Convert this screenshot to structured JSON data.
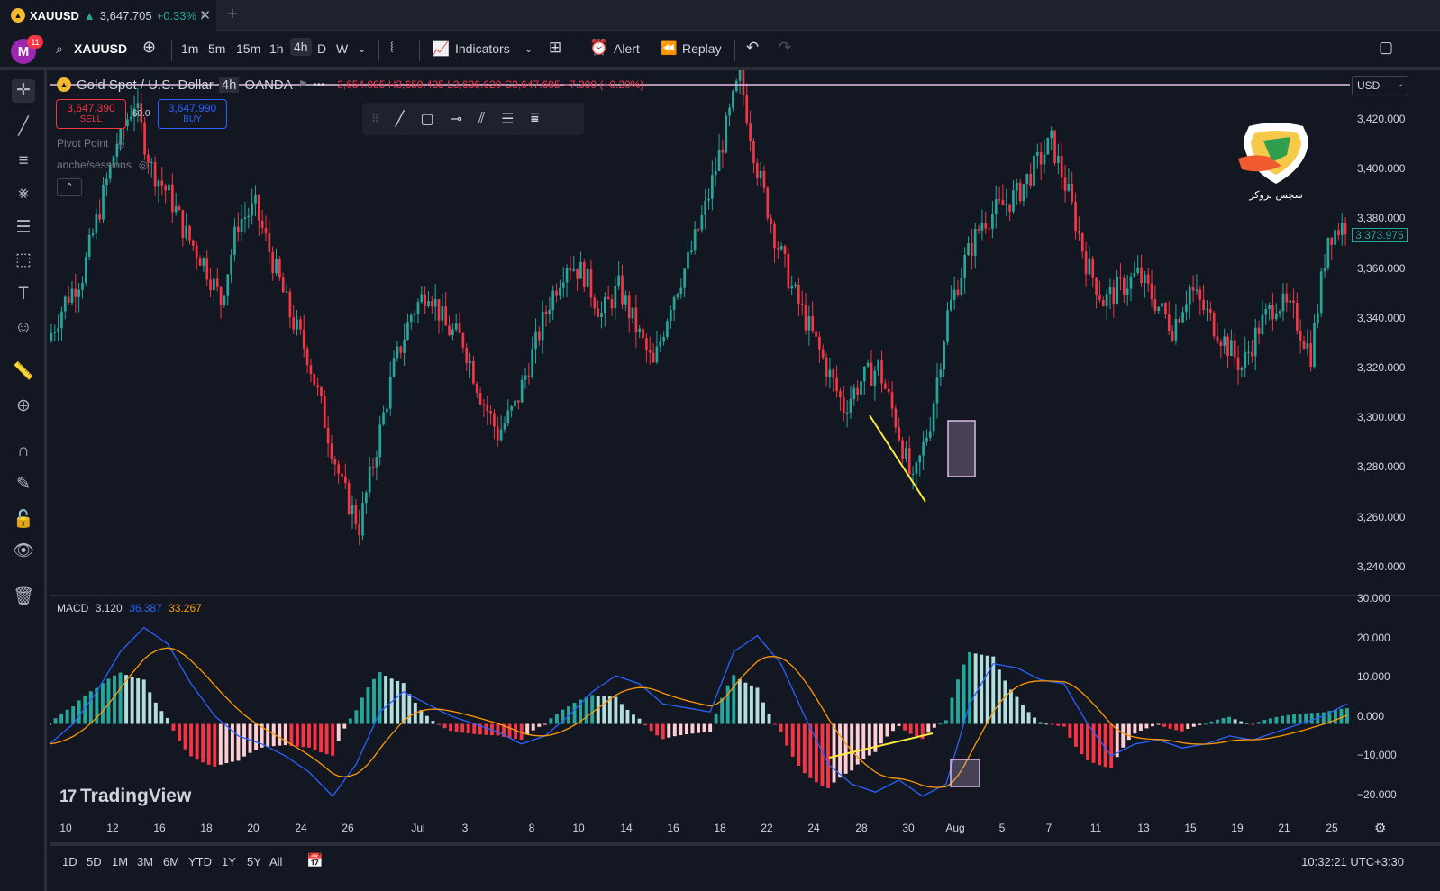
{
  "tab": {
    "symbol": "XAUUSD",
    "price": "3,647.705",
    "change": "+0.33%",
    "sep": "/",
    "coin_glyph": "▲"
  },
  "toolbar": {
    "avatar_letter": "M",
    "notifications": "11",
    "symbol": "XAUUSD",
    "intervals": [
      "1m",
      "5m",
      "15m",
      "1h",
      "4h",
      "D",
      "W"
    ],
    "active_interval": "4h",
    "indicators_label": "Indicators",
    "alert_label": "Alert",
    "replay_label": "Replay"
  },
  "legend": {
    "name": "Gold Spot / U.S. Dollar",
    "interval": "4h",
    "broker": "OANDA",
    "ohlc": "3,654.985 H3,659.435 L3,636.620 C3,647.695 −7.300 (−0.20%)",
    "sell_price": "3,647.390",
    "sell_label": "SELL",
    "buy_price": "3,647.990",
    "buy_label": "BUY",
    "spread": "60.0",
    "indicator1": "Pivot Point",
    "indicator2": "anche/sessions"
  },
  "price_axis": {
    "currency": "USD",
    "last_price": "3,373.975",
    "ticks": [
      "3,420.000",
      "3,400.000",
      "3,380.000",
      "3,360.000",
      "3,340.000",
      "3,320.000",
      "3,300.000",
      "3,280.000",
      "3,260.000",
      "3,240.000"
    ]
  },
  "macd": {
    "label": "MACD",
    "hist": "3.120",
    "macd": "36.387",
    "signal": "33.267",
    "ticks": [
      "30.000",
      "20.000",
      "10.000",
      "0.000",
      "−10.000",
      "−20.000"
    ]
  },
  "time_axis": {
    "labels": [
      "10",
      "12",
      "16",
      "18",
      "20",
      "24",
      "26",
      "Jul",
      "3",
      "8",
      "10",
      "14",
      "16",
      "18",
      "22",
      "24",
      "28",
      "30",
      "Aug",
      "5",
      "7",
      "11",
      "13",
      "15",
      "19",
      "21",
      "25"
    ]
  },
  "bottom": {
    "ranges": [
      "1D",
      "5D",
      "1M",
      "3M",
      "6M",
      "YTD",
      "1Y",
      "5Y",
      "All"
    ],
    "clock": "10:32:21 UTC+3:30"
  },
  "branding": {
    "tradingview": "TradingView",
    "watermark_text": "سجس بروکر"
  },
  "colors": {
    "up": "#26a69a",
    "down": "#f23645",
    "macd_line": "#2962ff",
    "signal_line": "#ff9800",
    "annotation": "#ffeb3b",
    "highlight_box": "#e1bee7"
  },
  "chart_data": {
    "type": "candlestick",
    "interval": "4h",
    "symbol": "XAUUSD",
    "ylim": [
      3235,
      3432
    ],
    "x_labels": [
      "10",
      "12",
      "16",
      "18",
      "20",
      "24",
      "26",
      "Jul",
      "3",
      "8",
      "10",
      "14",
      "16",
      "18",
      "22",
      "24",
      "28",
      "30",
      "Aug",
      "5",
      "7",
      "11",
      "13",
      "15",
      "19",
      "21",
      "25"
    ],
    "close_path_approx": [
      3330,
      3345,
      3355,
      3380,
      3405,
      3420,
      3395,
      3385,
      3370,
      3360,
      3345,
      3375,
      3380,
      3360,
      3340,
      3325,
      3300,
      3275,
      3260,
      3290,
      3320,
      3340,
      3350,
      3335,
      3330,
      3310,
      3295,
      3305,
      3325,
      3345,
      3360,
      3355,
      3340,
      3350,
      3335,
      3320,
      3345,
      3360,
      3380,
      3405,
      3430,
      3395,
      3370,
      3350,
      3335,
      3320,
      3305,
      3315,
      3320,
      3300,
      3275,
      3300,
      3340,
      3360,
      3375,
      3380,
      3385,
      3395,
      3405,
      3385,
      3360,
      3345,
      3350,
      3355,
      3345,
      3335,
      3350,
      3340,
      3330,
      3320,
      3335,
      3345,
      3340,
      3325,
      3370,
      3374
    ],
    "macd_path_approx": [
      -5,
      0,
      8,
      18,
      24,
      20,
      10,
      2,
      -3,
      -5,
      -8,
      -12,
      -18,
      -10,
      3,
      8,
      5,
      2,
      0,
      -2,
      -5,
      -3,
      2,
      8,
      12,
      10,
      5,
      4,
      3,
      18,
      22,
      15,
      2,
      -10,
      -15,
      -17,
      -14,
      -18,
      -15,
      5,
      15,
      14,
      11,
      10,
      0,
      -8,
      -5,
      -4,
      -6,
      -5,
      -3,
      -4,
      -2,
      0,
      2,
      5
    ]
  }
}
